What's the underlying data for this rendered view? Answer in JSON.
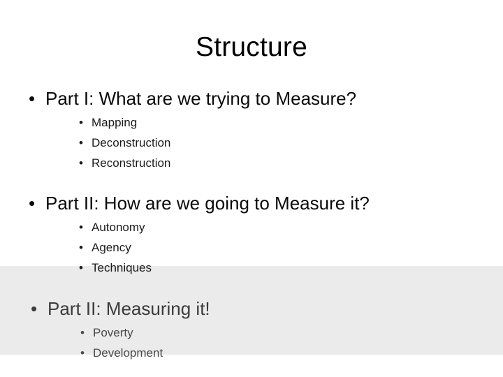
{
  "slide": {
    "title": "Structure",
    "background_color": "#ffffff",
    "band_color": "#ebebeb",
    "bullet_glyph": "•",
    "sections": [
      {
        "heading": "Part I: What are we trying to Measure?",
        "items": [
          "Mapping",
          "Deconstruction",
          "Reconstruction"
        ]
      },
      {
        "heading": "Part II: How are we going to Measure it?",
        "items": [
          "Autonomy",
          "Agency",
          "Techniques"
        ]
      },
      {
        "heading": "Part II: Measuring it!",
        "items": [
          "Poverty",
          "Development"
        ]
      }
    ]
  }
}
